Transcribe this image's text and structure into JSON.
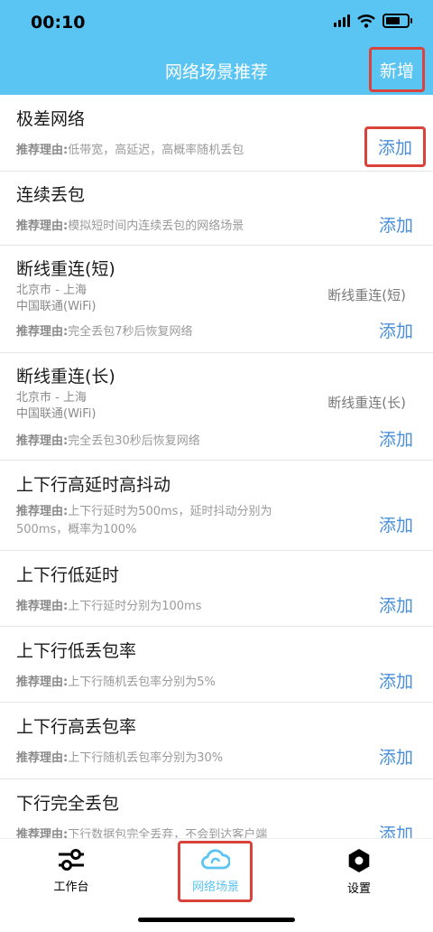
{
  "status": {
    "time": "00:10"
  },
  "nav": {
    "title": "网络场景推荐",
    "add_new": "新增"
  },
  "reason_label": "推荐理由:",
  "add_label": "添加",
  "items": [
    {
      "title": "极差网络",
      "reason": "低带宽，高延迟，高概率随机丢包"
    },
    {
      "title": "连续丢包",
      "reason": "模拟短时间内连续丢包的网络场景"
    },
    {
      "title": "断线重连(短)",
      "route": "北京市 - 上海",
      "carrier": "中国联通(WiFi)",
      "tag": "断线重连(短)",
      "reason": "完全丢包7秒后恢复网络"
    },
    {
      "title": "断线重连(长)",
      "route": "北京市 - 上海",
      "carrier": "中国联通(WiFi)",
      "tag": "断线重连(长)",
      "reason": "完全丢包30秒后恢复网络"
    },
    {
      "title": "上下行高延时高抖动",
      "reason_line1": "上下行延时为500ms，延时抖动分别为",
      "reason_line2": "500ms，概率为100%"
    },
    {
      "title": "上下行低延时",
      "reason": "上下行延时分别为100ms"
    },
    {
      "title": "上下行低丢包率",
      "reason": "上下行随机丢包率分别为5%"
    },
    {
      "title": "上下行高丢包率",
      "reason": "上下行随机丢包率分别为30%"
    },
    {
      "title": "下行完全丢包",
      "reason": "下行数据包完全丢弃，不会到达客户端"
    }
  ],
  "tabs": [
    {
      "label": "工作台",
      "icon": "sliders-icon"
    },
    {
      "label": "网络场景",
      "icon": "cloud-icon"
    },
    {
      "label": "设置",
      "icon": "gear-icon"
    }
  ],
  "colors": {
    "header": "#5ac4f2",
    "add": "#4a8fd8",
    "highlight": "#d9433b"
  }
}
